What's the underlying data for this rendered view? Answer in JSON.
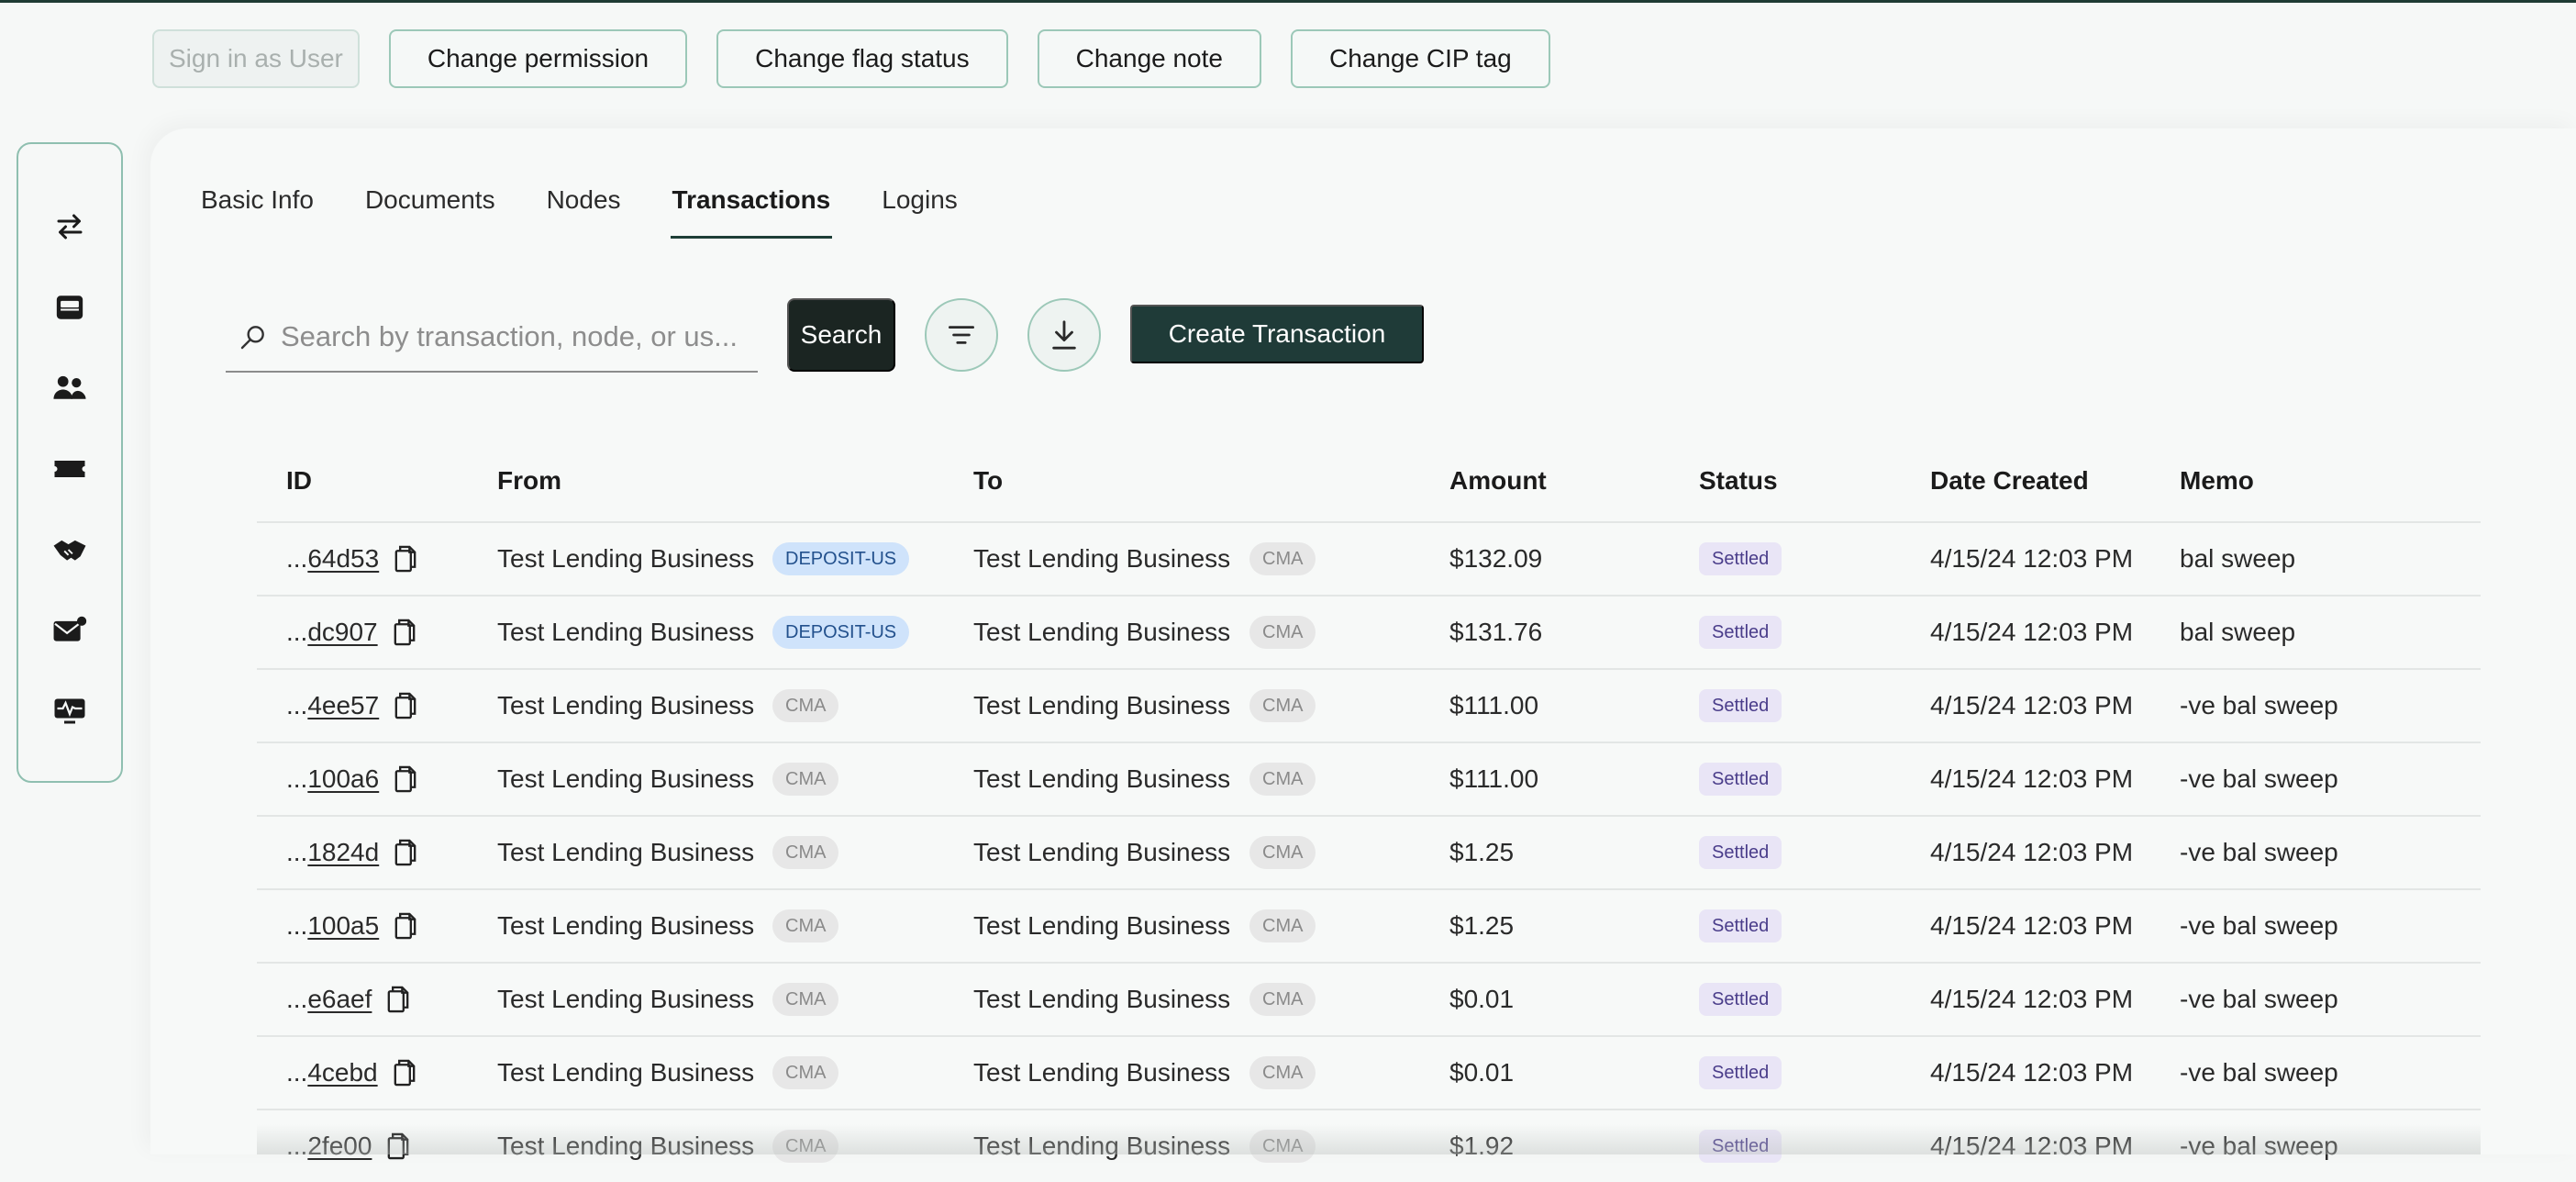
{
  "actions": [
    {
      "label": "Sign in as User",
      "disabled": true
    },
    {
      "label": "Change permission"
    },
    {
      "label": "Change flag status"
    },
    {
      "label": "Change note"
    },
    {
      "label": "Change CIP tag"
    }
  ],
  "sidebar": {
    "icons": [
      "transfer-arrows-icon",
      "inbox-icon",
      "users-icon",
      "ticket-icon",
      "handshake-icon",
      "mail-icon",
      "monitor-pulse-icon"
    ]
  },
  "tabs": [
    {
      "label": "Basic Info"
    },
    {
      "label": "Documents"
    },
    {
      "label": "Nodes"
    },
    {
      "label": "Transactions",
      "active": true
    },
    {
      "label": "Logins"
    }
  ],
  "search": {
    "placeholder": "Search by transaction, node, or us...",
    "button_label": "Search"
  },
  "toolbar": {
    "filter_icon": "filter-icon",
    "download_icon": "download-icon",
    "create_label": "Create Transaction"
  },
  "table": {
    "headers": {
      "id": "ID",
      "from": "From",
      "to": "To",
      "amount": "Amount",
      "status": "Status",
      "date": "Date Created",
      "memo": "Memo"
    },
    "rows": [
      {
        "id_prefix": "...",
        "id": "64d53",
        "from": "Test Lending Business",
        "from_tag": "DEPOSIT-US",
        "to": "Test Lending Business",
        "to_tag": "CMA",
        "amount": "$132.09",
        "status": "Settled",
        "date": "4/15/24 12:03 PM",
        "memo": "bal sweep"
      },
      {
        "id_prefix": "...",
        "id": "dc907",
        "from": "Test Lending Business",
        "from_tag": "DEPOSIT-US",
        "to": "Test Lending Business",
        "to_tag": "CMA",
        "amount": "$131.76",
        "status": "Settled",
        "date": "4/15/24 12:03 PM",
        "memo": "bal sweep"
      },
      {
        "id_prefix": "...",
        "id": "4ee57",
        "from": "Test Lending Business",
        "from_tag": "CMA",
        "to": "Test Lending Business",
        "to_tag": "CMA",
        "amount": "$111.00",
        "status": "Settled",
        "date": "4/15/24 12:03 PM",
        "memo": "-ve bal sweep"
      },
      {
        "id_prefix": "...",
        "id": "100a6",
        "from": "Test Lending Business",
        "from_tag": "CMA",
        "to": "Test Lending Business",
        "to_tag": "CMA",
        "amount": "$111.00",
        "status": "Settled",
        "date": "4/15/24 12:03 PM",
        "memo": "-ve bal sweep"
      },
      {
        "id_prefix": "...",
        "id": "1824d",
        "from": "Test Lending Business",
        "from_tag": "CMA",
        "to": "Test Lending Business",
        "to_tag": "CMA",
        "amount": "$1.25",
        "status": "Settled",
        "date": "4/15/24 12:03 PM",
        "memo": "-ve bal sweep"
      },
      {
        "id_prefix": "...",
        "id": "100a5",
        "from": "Test Lending Business",
        "from_tag": "CMA",
        "to": "Test Lending Business",
        "to_tag": "CMA",
        "amount": "$1.25",
        "status": "Settled",
        "date": "4/15/24 12:03 PM",
        "memo": "-ve bal sweep"
      },
      {
        "id_prefix": "...",
        "id": "e6aef",
        "from": "Test Lending Business",
        "from_tag": "CMA",
        "to": "Test Lending Business",
        "to_tag": "CMA",
        "amount": "$0.01",
        "status": "Settled",
        "date": "4/15/24 12:03 PM",
        "memo": "-ve bal sweep"
      },
      {
        "id_prefix": "...",
        "id": "4cebd",
        "from": "Test Lending Business",
        "from_tag": "CMA",
        "to": "Test Lending Business",
        "to_tag": "CMA",
        "amount": "$0.01",
        "status": "Settled",
        "date": "4/15/24 12:03 PM",
        "memo": "-ve bal sweep"
      },
      {
        "id_prefix": "...",
        "id": "2fe00",
        "from": "Test Lending Business",
        "from_tag": "CMA",
        "to": "Test Lending Business",
        "to_tag": "CMA",
        "amount": "$1.92",
        "status": "Settled",
        "date": "4/15/24 12:03 PM",
        "memo": "-ve bal sweep"
      }
    ]
  },
  "colors": {
    "accent_dark": "#1f3b38",
    "border_green": "#9cc8b8",
    "tag_deposit_bg": "#cfe3fb",
    "tag_cma_bg": "#e7e7e7",
    "settled_bg": "#e9e5f6"
  }
}
